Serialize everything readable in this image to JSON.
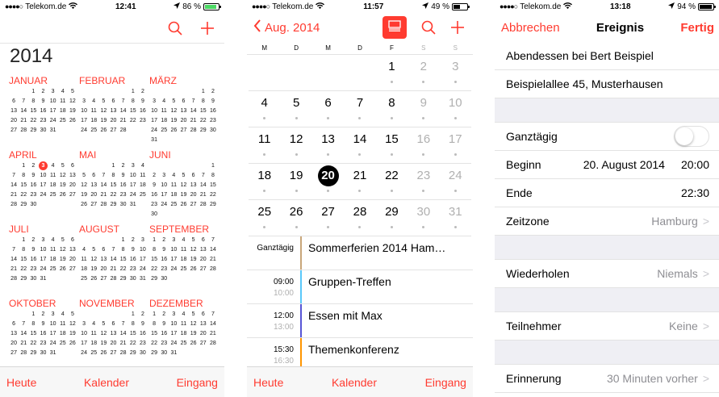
{
  "colors": {
    "accent": "#ff3b30",
    "battery_green": "#4cd964"
  },
  "phone1": {
    "status": {
      "carrier": "Telekom.de",
      "time": "12:41",
      "battery": "86 %",
      "battery_level": 0.86
    },
    "year": "2014",
    "months": [
      {
        "name": "JANUAR",
        "offset": 2,
        "days": 31
      },
      {
        "name": "FEBRUAR",
        "offset": 5,
        "days": 28
      },
      {
        "name": "MÄRZ",
        "offset": 5,
        "days": 31
      },
      {
        "name": "APRIL",
        "offset": 1,
        "days": 30,
        "today": 3
      },
      {
        "name": "MAI",
        "offset": 3,
        "days": 31
      },
      {
        "name": "JUNI",
        "offset": 6,
        "days": 30
      },
      {
        "name": "JULI",
        "offset": 1,
        "days": 31
      },
      {
        "name": "AUGUST",
        "offset": 4,
        "days": 31
      },
      {
        "name": "SEPTEMBER",
        "offset": 0,
        "days": 30
      },
      {
        "name": "OKTOBER",
        "offset": 2,
        "days": 31
      },
      {
        "name": "NOVEMBER",
        "offset": 5,
        "days": 30
      },
      {
        "name": "DEZEMBER",
        "offset": 0,
        "days": 31
      }
    ],
    "tabbar": {
      "today": "Heute",
      "calendars": "Kalender",
      "inbox": "Eingang"
    }
  },
  "phone2": {
    "status": {
      "carrier": "Telekom.de",
      "time": "11:57",
      "battery": "49 %",
      "battery_level": 0.49
    },
    "back_label": "Aug. 2014",
    "weekdays": [
      "M",
      "D",
      "M",
      "D",
      "F",
      "S",
      "S"
    ],
    "offset": 4,
    "days": [
      1,
      2,
      3,
      4,
      5,
      6,
      7,
      8,
      9,
      10,
      11,
      12,
      13,
      14,
      15,
      16,
      17,
      18,
      19,
      20,
      21,
      22,
      23,
      24,
      25,
      26,
      27,
      28,
      29,
      30,
      31
    ],
    "selected_day": 20,
    "events": [
      {
        "start": "Ganztägig",
        "end": "",
        "title": "Sommerferien 2014 Ham…",
        "color": "#c8a67a"
      },
      {
        "start": "09:00",
        "end": "10:00",
        "title": "Gruppen-Treffen",
        "color": "#5ac8fa"
      },
      {
        "start": "12:00",
        "end": "13:00",
        "title": "Essen mit Max",
        "color": "#5856d6"
      },
      {
        "start": "15:30",
        "end": "16:30",
        "title": "Themenkonferenz",
        "color": "#ff9500"
      }
    ],
    "tabbar": {
      "today": "Heute",
      "calendars": "Kalender",
      "inbox": "Eingang"
    }
  },
  "phone3": {
    "status": {
      "carrier": "Telekom.de",
      "time": "13:18",
      "battery": "94 %",
      "battery_level": 0.94
    },
    "nav": {
      "cancel": "Abbrechen",
      "title": "Ereignis",
      "done": "Fertig"
    },
    "event_title": "Abendessen bei Bert Beispiel",
    "location": "Beispielallee 45, Musterhausen",
    "all_day_label": "Ganztägig",
    "all_day_on": false,
    "start_label": "Beginn",
    "start_date": "20. August 2014",
    "start_time": "20:00",
    "end_label": "Ende",
    "end_time": "22:30",
    "timezone_label": "Zeitzone",
    "timezone_value": "Hamburg",
    "repeat_label": "Wiederholen",
    "repeat_value": "Niemals",
    "invitees_label": "Teilnehmer",
    "invitees_value": "Keine",
    "alert_label": "Erinnerung",
    "alert_value": "30 Minuten vorher"
  }
}
